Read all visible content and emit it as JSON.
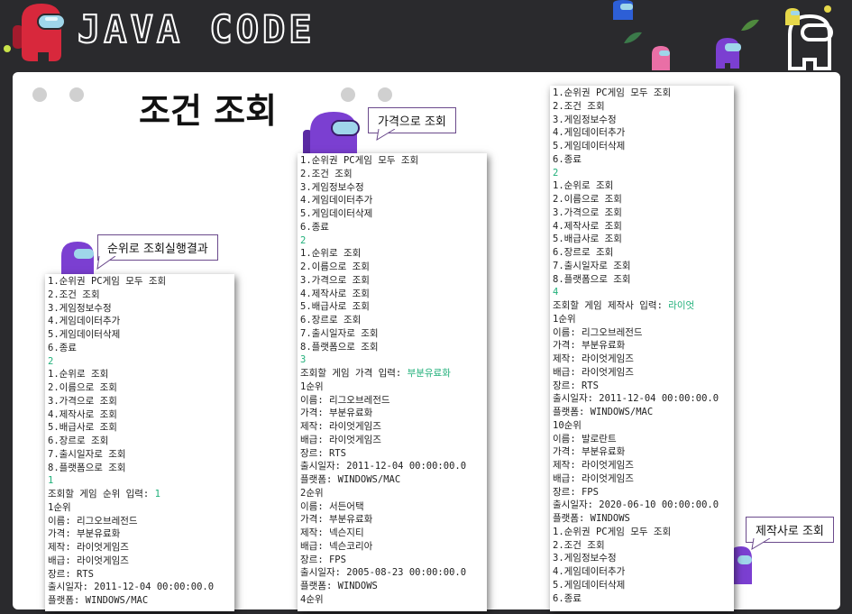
{
  "header": {
    "title": "JAVA CODE"
  },
  "slide": {
    "title": "조건 조회"
  },
  "callouts": {
    "rank": "순위로 조회실행결과",
    "price": "가격으로 조회",
    "maker": "제작사로 조회"
  },
  "colors": {
    "accent_green": "#21b07a",
    "crew_purple": "#7b3fd1",
    "crew_red": "#d8283c",
    "callout_border": "#6b4a8c"
  },
  "consoles": {
    "left": [
      {
        "t": "1.순위권 PC게임 모두 조회"
      },
      {
        "t": "2.조건 조회"
      },
      {
        "t": "3.게임정보수정"
      },
      {
        "t": "4.게임데이터추가"
      },
      {
        "t": "5.게임데이터삭제"
      },
      {
        "t": "6.종료"
      },
      {
        "t": "2",
        "g": true
      },
      {
        "t": "1.순위로 조회"
      },
      {
        "t": "2.이름으로 조회"
      },
      {
        "t": "3.가격으로 조회"
      },
      {
        "t": "4.제작사로 조회"
      },
      {
        "t": "5.배급사로 조회"
      },
      {
        "t": "6.장르로 조회"
      },
      {
        "t": "7.출시일자로 조회"
      },
      {
        "t": "8.플랫폼으로 조회"
      },
      {
        "t": "1",
        "g": true
      },
      {
        "t": "조회할 게임 순위 입력: ",
        "in": "1"
      },
      {
        "t": "1순위"
      },
      {
        "t": "이름: 리그오브레전드"
      },
      {
        "t": "가격: 부분유료화"
      },
      {
        "t": "제작: 라이엇게임즈"
      },
      {
        "t": "배급: 라이엇게임즈"
      },
      {
        "t": "장르: RTS"
      },
      {
        "t": "출시일자: 2011-12-04 00:00:00.0"
      },
      {
        "t": "플랫폼: WINDOWS/MAC"
      }
    ],
    "middle": [
      {
        "t": "1.순위권 PC게임 모두 조회"
      },
      {
        "t": "2.조건 조회"
      },
      {
        "t": "3.게임정보수정"
      },
      {
        "t": "4.게임데이터추가"
      },
      {
        "t": "5.게임데이터삭제"
      },
      {
        "t": "6.종료"
      },
      {
        "t": "2",
        "g": true
      },
      {
        "t": "1.순위로 조회"
      },
      {
        "t": "2.이름으로 조회"
      },
      {
        "t": "3.가격으로 조회"
      },
      {
        "t": "4.제작사로 조회"
      },
      {
        "t": "5.배급사로 조회"
      },
      {
        "t": "6.장르로 조회"
      },
      {
        "t": "7.출시일자로 조회"
      },
      {
        "t": "8.플랫폼으로 조회"
      },
      {
        "t": "3",
        "g": true
      },
      {
        "t": "조회할 게임 가격 입력: ",
        "in": "부분유료화"
      },
      {
        "t": "1순위"
      },
      {
        "t": "이름: 리그오브레전드"
      },
      {
        "t": "가격: 부분유료화"
      },
      {
        "t": "제작: 라이엇게임즈"
      },
      {
        "t": "배급: 라이엇게임즈"
      },
      {
        "t": "장르: RTS"
      },
      {
        "t": "출시일자: 2011-12-04 00:00:00.0"
      },
      {
        "t": "플랫폼: WINDOWS/MAC"
      },
      {
        "t": "2순위"
      },
      {
        "t": "이름: 서든어택"
      },
      {
        "t": "가격: 부분유료화"
      },
      {
        "t": "제작: 넥슨지티"
      },
      {
        "t": "배급: 넥슨코리아"
      },
      {
        "t": "장르: FPS"
      },
      {
        "t": "출시일자: 2005-08-23 00:00:00.0"
      },
      {
        "t": "플랫폼: WINDOWS"
      },
      {
        "t": "4순위"
      }
    ],
    "right": [
      {
        "t": "1.순위권 PC게임 모두 조회"
      },
      {
        "t": "2.조건 조회"
      },
      {
        "t": "3.게임정보수정"
      },
      {
        "t": "4.게임데이터추가"
      },
      {
        "t": "5.게임데이터삭제"
      },
      {
        "t": "6.종료"
      },
      {
        "t": "2",
        "g": true
      },
      {
        "t": "1.순위로 조회"
      },
      {
        "t": "2.이름으로 조회"
      },
      {
        "t": "3.가격으로 조회"
      },
      {
        "t": "4.제작사로 조회"
      },
      {
        "t": "5.배급사로 조회"
      },
      {
        "t": "6.장르로 조회"
      },
      {
        "t": "7.출시일자로 조회"
      },
      {
        "t": "8.플랫폼으로 조회"
      },
      {
        "t": "4",
        "g": true
      },
      {
        "t": "조회할 게임 제작사 입력: ",
        "in": "라이엇"
      },
      {
        "t": "1순위"
      },
      {
        "t": "이름: 리그오브레전드"
      },
      {
        "t": "가격: 부분유료화"
      },
      {
        "t": "제작: 라이엇게임즈"
      },
      {
        "t": "배급: 라이엇게임즈"
      },
      {
        "t": "장르: RTS"
      },
      {
        "t": "출시일자: 2011-12-04 00:00:00.0"
      },
      {
        "t": "플랫폼: WINDOWS/MAC"
      },
      {
        "t": "10순위"
      },
      {
        "t": "이름: 발로란트"
      },
      {
        "t": "가격: 부분유료화"
      },
      {
        "t": "제작: 라이엇게임즈"
      },
      {
        "t": "배급: 라이엇게임즈"
      },
      {
        "t": "장르: FPS"
      },
      {
        "t": "출시일자: 2020-06-10 00:00:00.0"
      },
      {
        "t": "플랫폼: WINDOWS"
      },
      {
        "t": "1.순위권 PC게임 모두 조회"
      },
      {
        "t": "2.조건 조회"
      },
      {
        "t": "3.게임정보수정"
      },
      {
        "t": "4.게임데이터추가"
      },
      {
        "t": "5.게임데이터삭제"
      },
      {
        "t": "6.종료"
      }
    ]
  }
}
